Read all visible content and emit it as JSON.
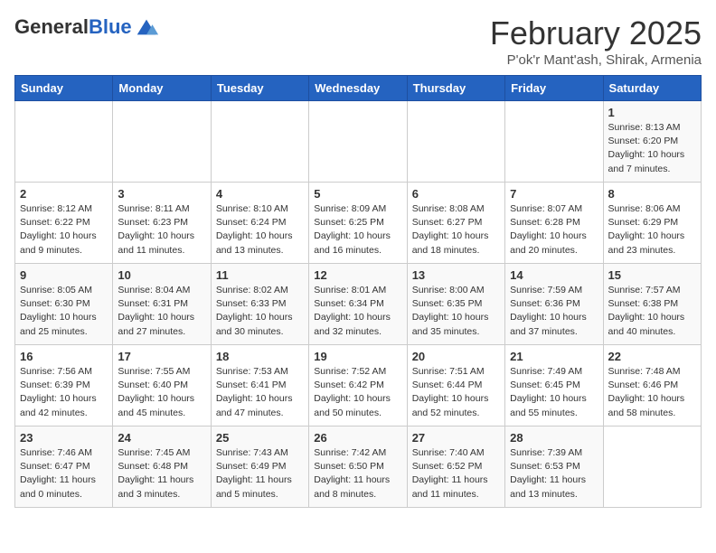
{
  "header": {
    "logo_general": "General",
    "logo_blue": "Blue",
    "month_title": "February 2025",
    "subtitle": "P'ok'r Mant'ash, Shirak, Armenia"
  },
  "days_of_week": [
    "Sunday",
    "Monday",
    "Tuesday",
    "Wednesday",
    "Thursday",
    "Friday",
    "Saturday"
  ],
  "weeks": [
    [
      {
        "day": "",
        "info": ""
      },
      {
        "day": "",
        "info": ""
      },
      {
        "day": "",
        "info": ""
      },
      {
        "day": "",
        "info": ""
      },
      {
        "day": "",
        "info": ""
      },
      {
        "day": "",
        "info": ""
      },
      {
        "day": "1",
        "info": "Sunrise: 8:13 AM\nSunset: 6:20 PM\nDaylight: 10 hours\nand 7 minutes."
      }
    ],
    [
      {
        "day": "2",
        "info": "Sunrise: 8:12 AM\nSunset: 6:22 PM\nDaylight: 10 hours\nand 9 minutes."
      },
      {
        "day": "3",
        "info": "Sunrise: 8:11 AM\nSunset: 6:23 PM\nDaylight: 10 hours\nand 11 minutes."
      },
      {
        "day": "4",
        "info": "Sunrise: 8:10 AM\nSunset: 6:24 PM\nDaylight: 10 hours\nand 13 minutes."
      },
      {
        "day": "5",
        "info": "Sunrise: 8:09 AM\nSunset: 6:25 PM\nDaylight: 10 hours\nand 16 minutes."
      },
      {
        "day": "6",
        "info": "Sunrise: 8:08 AM\nSunset: 6:27 PM\nDaylight: 10 hours\nand 18 minutes."
      },
      {
        "day": "7",
        "info": "Sunrise: 8:07 AM\nSunset: 6:28 PM\nDaylight: 10 hours\nand 20 minutes."
      },
      {
        "day": "8",
        "info": "Sunrise: 8:06 AM\nSunset: 6:29 PM\nDaylight: 10 hours\nand 23 minutes."
      }
    ],
    [
      {
        "day": "9",
        "info": "Sunrise: 8:05 AM\nSunset: 6:30 PM\nDaylight: 10 hours\nand 25 minutes."
      },
      {
        "day": "10",
        "info": "Sunrise: 8:04 AM\nSunset: 6:31 PM\nDaylight: 10 hours\nand 27 minutes."
      },
      {
        "day": "11",
        "info": "Sunrise: 8:02 AM\nSunset: 6:33 PM\nDaylight: 10 hours\nand 30 minutes."
      },
      {
        "day": "12",
        "info": "Sunrise: 8:01 AM\nSunset: 6:34 PM\nDaylight: 10 hours\nand 32 minutes."
      },
      {
        "day": "13",
        "info": "Sunrise: 8:00 AM\nSunset: 6:35 PM\nDaylight: 10 hours\nand 35 minutes."
      },
      {
        "day": "14",
        "info": "Sunrise: 7:59 AM\nSunset: 6:36 PM\nDaylight: 10 hours\nand 37 minutes."
      },
      {
        "day": "15",
        "info": "Sunrise: 7:57 AM\nSunset: 6:38 PM\nDaylight: 10 hours\nand 40 minutes."
      }
    ],
    [
      {
        "day": "16",
        "info": "Sunrise: 7:56 AM\nSunset: 6:39 PM\nDaylight: 10 hours\nand 42 minutes."
      },
      {
        "day": "17",
        "info": "Sunrise: 7:55 AM\nSunset: 6:40 PM\nDaylight: 10 hours\nand 45 minutes."
      },
      {
        "day": "18",
        "info": "Sunrise: 7:53 AM\nSunset: 6:41 PM\nDaylight: 10 hours\nand 47 minutes."
      },
      {
        "day": "19",
        "info": "Sunrise: 7:52 AM\nSunset: 6:42 PM\nDaylight: 10 hours\nand 50 minutes."
      },
      {
        "day": "20",
        "info": "Sunrise: 7:51 AM\nSunset: 6:44 PM\nDaylight: 10 hours\nand 52 minutes."
      },
      {
        "day": "21",
        "info": "Sunrise: 7:49 AM\nSunset: 6:45 PM\nDaylight: 10 hours\nand 55 minutes."
      },
      {
        "day": "22",
        "info": "Sunrise: 7:48 AM\nSunset: 6:46 PM\nDaylight: 10 hours\nand 58 minutes."
      }
    ],
    [
      {
        "day": "23",
        "info": "Sunrise: 7:46 AM\nSunset: 6:47 PM\nDaylight: 11 hours\nand 0 minutes."
      },
      {
        "day": "24",
        "info": "Sunrise: 7:45 AM\nSunset: 6:48 PM\nDaylight: 11 hours\nand 3 minutes."
      },
      {
        "day": "25",
        "info": "Sunrise: 7:43 AM\nSunset: 6:49 PM\nDaylight: 11 hours\nand 5 minutes."
      },
      {
        "day": "26",
        "info": "Sunrise: 7:42 AM\nSunset: 6:50 PM\nDaylight: 11 hours\nand 8 minutes."
      },
      {
        "day": "27",
        "info": "Sunrise: 7:40 AM\nSunset: 6:52 PM\nDaylight: 11 hours\nand 11 minutes."
      },
      {
        "day": "28",
        "info": "Sunrise: 7:39 AM\nSunset: 6:53 PM\nDaylight: 11 hours\nand 13 minutes."
      },
      {
        "day": "",
        "info": ""
      }
    ]
  ]
}
